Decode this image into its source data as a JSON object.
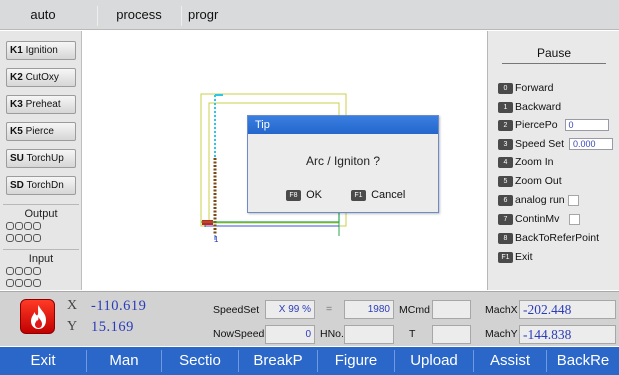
{
  "top_tabs": [
    "auto",
    "process",
    "progr"
  ],
  "left_panel": {
    "buttons": [
      {
        "key": "K1",
        "label": "Ignition"
      },
      {
        "key": "K2",
        "label": "CutOxy"
      },
      {
        "key": "K3",
        "label": "Preheat"
      },
      {
        "key": "K5",
        "label": "Pierce"
      },
      {
        "key": "SU",
        "label": "TorchUp"
      },
      {
        "key": "SD",
        "label": "TorchDn"
      }
    ],
    "output_label": "Output",
    "input_label": "Input"
  },
  "canvas": {
    "point_label": "1"
  },
  "dialog": {
    "title": "Tip",
    "message": "Arc / Igniton ?",
    "ok_key": "F8",
    "ok_label": "OK",
    "cancel_key": "F1",
    "cancel_label": "Cancel"
  },
  "right_panel": {
    "title": "Pause",
    "items": [
      {
        "key": "0",
        "label": "Forward"
      },
      {
        "key": "1",
        "label": "Backward"
      },
      {
        "key": "2",
        "label": "PiercePo",
        "value": "0"
      },
      {
        "key": "3",
        "label": "Speed Set",
        "value": "0.000"
      },
      {
        "key": "4",
        "label": "Zoom In"
      },
      {
        "key": "5",
        "label": "Zoom Out"
      },
      {
        "key": "6",
        "label": "analog run"
      },
      {
        "key": "7",
        "label": "ContinMv"
      },
      {
        "key": "8",
        "label": "BackToReferPoint"
      },
      {
        "key": "F1",
        "label": "Exit"
      }
    ]
  },
  "info": {
    "x_axis": "X",
    "y_axis": "Y",
    "x_value": "-110.619",
    "y_value": "15.169",
    "speedset_label": "SpeedSet",
    "speedset_value": "X 99 %",
    "eq_label": "=",
    "speedset_rate": "1980",
    "mcmd_label": "MCmd",
    "mcmd_value": "",
    "nowspeed_label": "NowSpeed",
    "nowspeed_value": "0",
    "hno_label": "HNo.",
    "hno_value": "",
    "t_label": "T",
    "t_value": "",
    "machx_label": "MachX",
    "machx_value": "-202.448",
    "machy_label": "MachY",
    "machy_value": "-144.838"
  },
  "function_keys": [
    "Exit",
    "Man",
    "Sectio",
    "BreakP",
    "Figure",
    "Upload",
    "Assist",
    "BackRe"
  ],
  "colors": {
    "function_bar": "#2a67c8",
    "dialog_title": "#2466cc",
    "coord_text": "#2b3cb8",
    "path_yellow": "#c8d24a",
    "path_green": "#2aa84a",
    "path_cyan": "#2cc6e6",
    "path_brown": "#7a4a16",
    "marker_red": "#e2161a",
    "flame_icon": "#d8140a"
  }
}
